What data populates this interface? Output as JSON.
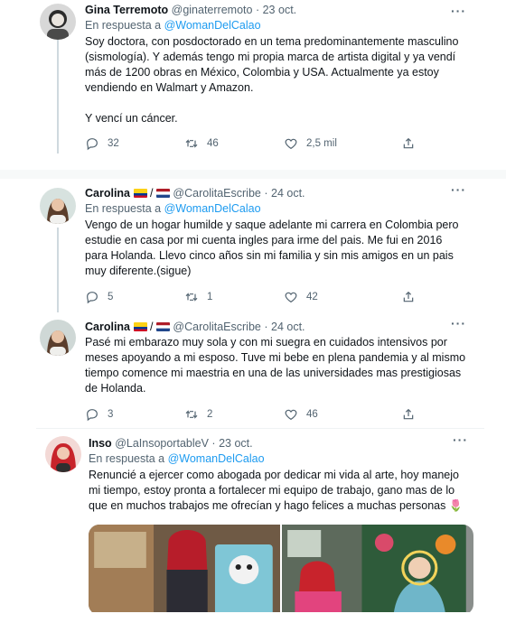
{
  "tweets": [
    {
      "name": "Gina Terremoto",
      "handle": "@ginaterremoto",
      "date": "23 oct.",
      "reply_prefix": "En respuesta a",
      "reply_to": "@WomanDelCalao",
      "text": "Soy doctora, con posdoctorado en un tema predominantemente masculino (sismología). Y además tengo mi propia marca de artista digital y ya vendí más de 1200 obras en México, Colombia y USA. Actualmente ya estoy vendiendo en Walmart y Amazon.\n\nY vencí un cáncer.",
      "replies": "32",
      "retweets": "46",
      "likes": "2,5 mil"
    },
    {
      "name": "Carolina",
      "flags": [
        "colombia",
        "netherlands"
      ],
      "handle": "@CarolitaEscribe",
      "date": "24 oct.",
      "reply_prefix": "En respuesta a",
      "reply_to": "@WomanDelCalao",
      "text": "Vengo de un hogar humilde y saque adelante mi carrera en Colombia pero estudie en casa por mi cuenta ingles para irme del pais. Me fui en 2016 para Holanda. Llevo cinco años sin mi familia y sin mis amigos en un pais muy diferente.(sigue)",
      "replies": "5",
      "retweets": "1",
      "likes": "42"
    },
    {
      "name": "Carolina",
      "flags": [
        "colombia",
        "netherlands"
      ],
      "handle": "@CarolitaEscribe",
      "date": "24 oct.",
      "text": "Pasé mi embarazo muy sola y con mi suegra en cuidados intensivos por meses apoyando a mi esposo. Tuve mi bebe en plena pandemia y al mismo tiempo comence mi maestria en una de las universidades mas prestigiosas de Holanda.",
      "replies": "3",
      "retweets": "2",
      "likes": "46"
    },
    {
      "name": "Inso",
      "handle": "@LaInsoportableV",
      "date": "23 oct.",
      "reply_prefix": "En respuesta a",
      "reply_to": "@WomanDelCalao",
      "text": "Renuncié a ejercer como abogada por dedicar mi vida al arte, hoy manejo mi tiempo, estoy pronta a fortalecer mi equipo de trabajo, gano mas de lo que en muchos trabajos me ofrecían y hago felices a muchas personas 🌷"
    }
  ],
  "dot_separator": "·",
  "more_label": "···",
  "icons": {
    "reply": "reply-icon",
    "retweet": "retweet-icon",
    "like": "heart-icon",
    "share": "share-icon"
  },
  "colors": {
    "link": "#1d9bf0",
    "secondary": "#536471",
    "text": "#0f1419"
  }
}
